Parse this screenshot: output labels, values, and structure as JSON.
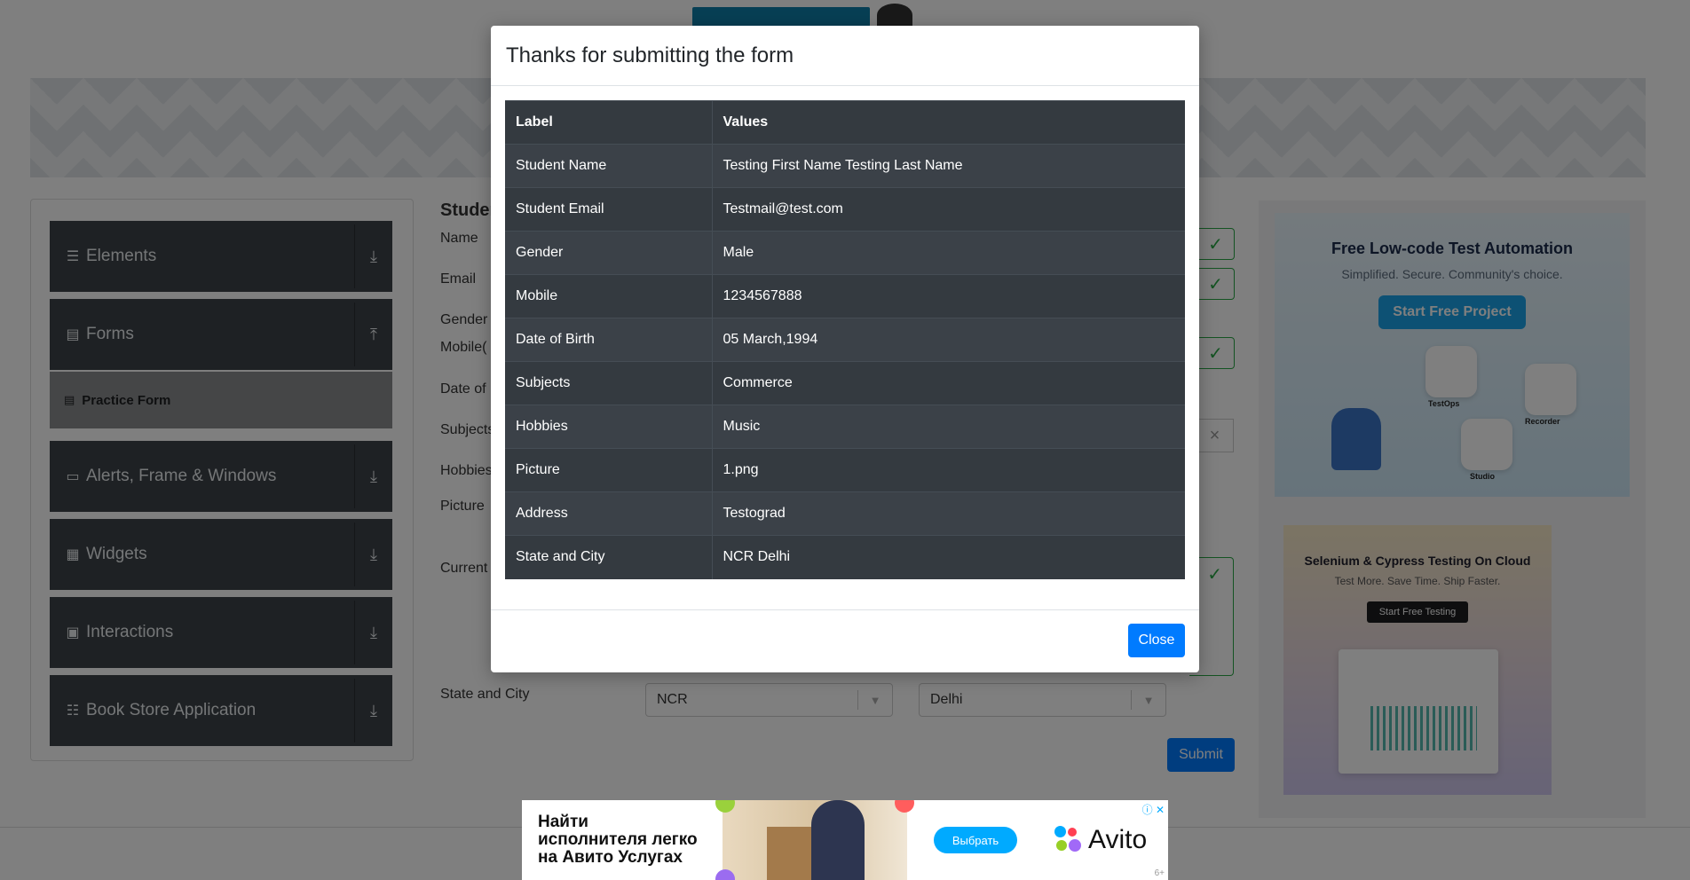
{
  "sidebar": {
    "groups": [
      {
        "icon": "menu-icon",
        "label": "Elements"
      },
      {
        "icon": "document-icon",
        "label": "Forms"
      },
      {
        "icon": "window-icon",
        "label": "Alerts, Frame & Windows"
      },
      {
        "icon": "widgets-icon",
        "label": "Widgets"
      },
      {
        "icon": "interactions-icon",
        "label": "Interactions"
      },
      {
        "icon": "books-icon",
        "label": "Book Store Application"
      }
    ],
    "active_item": "Practice Form"
  },
  "form": {
    "title_partial": "Studer",
    "labels": {
      "name": "Name",
      "email": "Email",
      "gender": "Gender",
      "mobile": "Mobile(",
      "dob": "Date of",
      "subjects": "Subjects",
      "hobbies": "Hobbies",
      "picture": "Picture",
      "current_address": "Current",
      "state_city": "State and City"
    },
    "state_value": "NCR",
    "city_value": "Delhi",
    "submit_label": "Submit"
  },
  "ads": {
    "right_top": {
      "title": "Free Low-code Test Automation",
      "subtitle": "Simplified. Secure. Community's choice.",
      "button": "Start Free Project",
      "labels": [
        "TestOps",
        "Recorder",
        "Studio"
      ]
    },
    "right_bottom": {
      "title": "Selenium & Cypress Testing On Cloud",
      "subtitle": "Test More. Save Time. Ship Faster.",
      "button": "Start Free Testing"
    },
    "bottom": {
      "text_line1": "Найти",
      "text_line2": "исполнителя легко",
      "text_line3": "на Авито Услугах",
      "button": "Выбрать",
      "brand": "Avito",
      "age": "6+"
    }
  },
  "modal": {
    "title": "Thanks for submitting the form",
    "table": {
      "headers": [
        "Label",
        "Values"
      ],
      "rows": [
        [
          "Student Name",
          "Testing First Name Testing Last Name"
        ],
        [
          "Student Email",
          "Testmail@test.com"
        ],
        [
          "Gender",
          "Male"
        ],
        [
          "Mobile",
          "1234567888"
        ],
        [
          "Date of Birth",
          "05 March,1994"
        ],
        [
          "Subjects",
          "Commerce"
        ],
        [
          "Hobbies",
          "Music"
        ],
        [
          "Picture",
          "1.png"
        ],
        [
          "Address",
          "Testograd"
        ],
        [
          "State and City",
          "NCR Delhi"
        ]
      ]
    },
    "close_label": "Close"
  },
  "colors": {
    "primary": "#007bff",
    "table_dark": "#343a40",
    "sidebar_dark": "#3d4248",
    "valid_green": "#28a745"
  }
}
